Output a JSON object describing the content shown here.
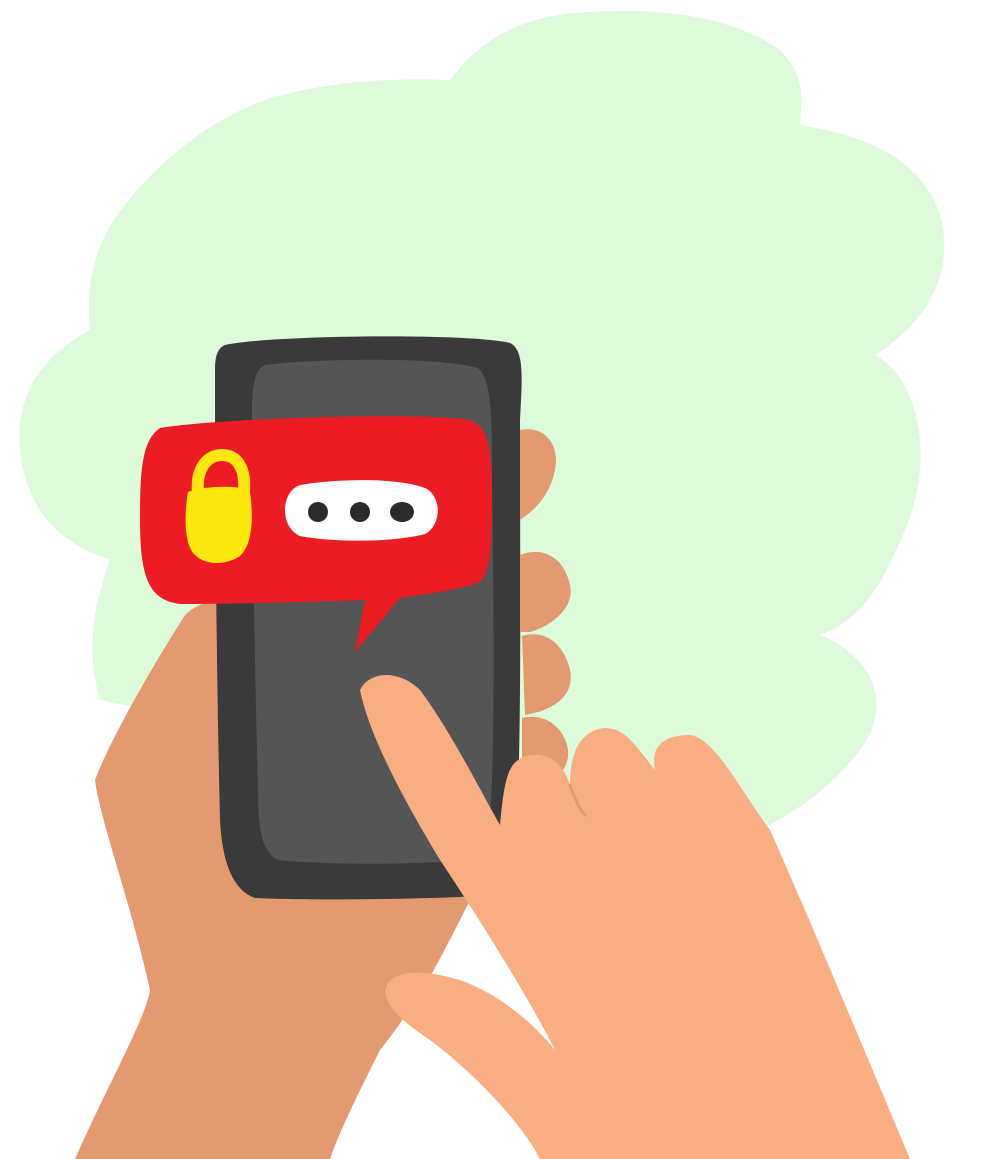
{
  "illustration": {
    "subject": "hands-holding-phone-unlocked-notification",
    "icons": [
      "unlocked-padlock-icon",
      "password-dots-icon",
      "speech-bubble-icon",
      "smartphone-icon"
    ],
    "password_dot_count": 3,
    "colors": {
      "background": "#ffffff",
      "cloud": "#ddfadb",
      "phone_body": "#3a3a3a",
      "phone_screen": "#555555",
      "bubble": "#ec1c24",
      "padlock": "#fce80e",
      "dots_pill": "#ffffff",
      "dots": "#2b2b2b",
      "hand_back": "#e39a70",
      "hand_front": "#f8ad83"
    }
  }
}
